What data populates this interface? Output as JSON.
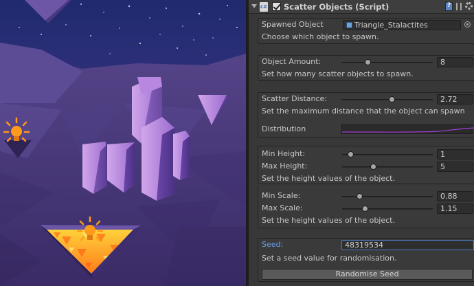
{
  "component": {
    "title": "Scatter Objects (Script)",
    "enabled": true
  },
  "spawn": {
    "label": "Spawned Object",
    "value": "Triangle_Stalactites",
    "description": "Choose which object to spawn."
  },
  "amount": {
    "label": "Object Amount:",
    "value": "8",
    "slider_fraction": 0.29,
    "description": "Set how many scatter objects to spawn."
  },
  "distance": {
    "label": "Scatter Distance:",
    "value": "2.72",
    "slider_fraction": 0.55,
    "description": "Set the maximum distance that the object can spawn",
    "distribution_label": "Distribution"
  },
  "height": {
    "min_label": "Min Height:",
    "min_value": "1",
    "min_fraction": 0.1,
    "max_label": "Max Height:",
    "max_value": "5",
    "max_fraction": 0.35,
    "description": "Set the height values of the object."
  },
  "scale": {
    "min_label": "Min Scale:",
    "min_value": "0.88",
    "min_fraction": 0.2,
    "max_label": "Max Scale:",
    "max_value": "1.15",
    "max_fraction": 0.26,
    "description": "Set the height values of the object."
  },
  "seed": {
    "label": "Seed:",
    "value": "48319534",
    "description": "Set a seed value for randomisation.",
    "button": "Randomise Seed"
  },
  "colors": {
    "seed_accent": "#6d9ee8",
    "curve_line": "#a03fd6",
    "light_icon": "#ff9a1a"
  },
  "icons": [
    "foldout-arrow-icon",
    "script-icon",
    "help-icon",
    "preset-icon",
    "gear-icon",
    "object-picker-icon",
    "light-bulb-icon"
  ]
}
